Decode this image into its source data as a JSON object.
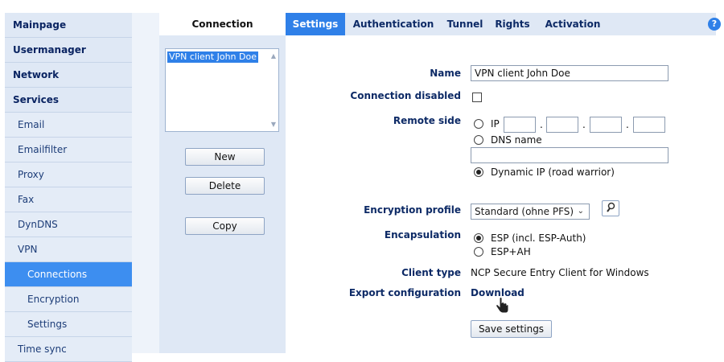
{
  "sidebar": {
    "items": [
      {
        "label": "Mainpage"
      },
      {
        "label": "Usermanager"
      },
      {
        "label": "Network"
      },
      {
        "label": "Services"
      },
      {
        "label": "Email"
      },
      {
        "label": "Emailfilter"
      },
      {
        "label": "Proxy"
      },
      {
        "label": "Fax"
      },
      {
        "label": "DynDNS"
      },
      {
        "label": "VPN"
      },
      {
        "label": "Connections"
      },
      {
        "label": "Encryption"
      },
      {
        "label": "Settings"
      },
      {
        "label": "Time sync"
      }
    ]
  },
  "tabs": {
    "connection": "Connection",
    "items": [
      {
        "label": "Settings"
      },
      {
        "label": "Authentication"
      },
      {
        "label": "Tunnel"
      },
      {
        "label": "Rights"
      },
      {
        "label": "Activation"
      }
    ],
    "help": "?"
  },
  "connections": {
    "list": [
      "VPN client John Doe"
    ],
    "new_label": "New",
    "delete_label": "Delete",
    "copy_label": "Copy"
  },
  "form": {
    "name_label": "Name",
    "name_value": "VPN client John Doe",
    "disabled_label": "Connection disabled",
    "remote_label": "Remote side",
    "remote_ip_option": "IP",
    "ip_dot": ".",
    "remote_dns_option": "DNS name",
    "remote_dynamic_option": "Dynamic IP (road warrior)",
    "encryption_label": "Encryption profile",
    "encryption_value": "Standard (ohne PFS)",
    "encap_label": "Encapsulation",
    "encap_esp": "ESP (incl. ESP-Auth)",
    "encap_espah": "ESP+AH",
    "client_type_label": "Client type",
    "client_type_value": "NCP Secure Entry Client for Windows",
    "export_label": "Export configuration",
    "export_link": "Download",
    "save_label": "Save settings"
  }
}
